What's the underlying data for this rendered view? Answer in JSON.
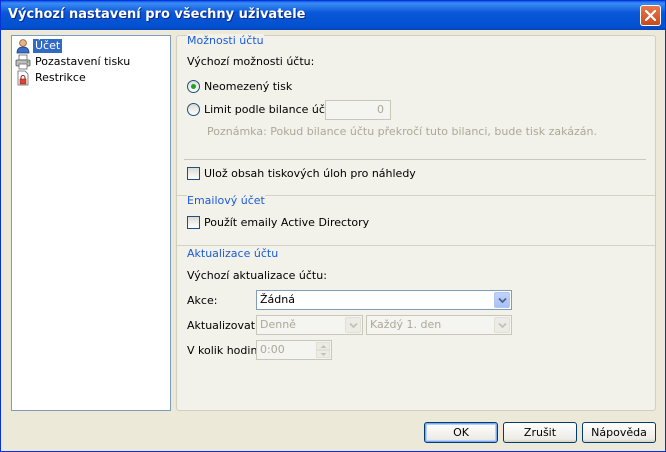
{
  "window": {
    "title": "Výchozí nastavení pro všechny uživatele"
  },
  "tree": {
    "items": [
      {
        "label": "Účet",
        "icon": "user-icon",
        "selected": true
      },
      {
        "label": "Pozastavení tisku",
        "icon": "printer-icon",
        "selected": false
      },
      {
        "label": "Restrikce",
        "icon": "document-lock-icon",
        "selected": false
      }
    ]
  },
  "account_options": {
    "title": "Možnosti účtu",
    "default_label": "Výchozí možnosti účtu:",
    "radio_unlimited": "Neomezený tisk",
    "radio_unlimited_selected": true,
    "radio_limit": "Limit podle bilance účtu:",
    "limit_value": "0",
    "note": "Poznámka: Pokud bilance účtu překročí tuto bilanci, bude tisk zakázán.",
    "store_previews": "Ulož obsah tiskových úloh pro náhledy"
  },
  "email_account": {
    "title": "Emailový účet",
    "use_ad_emails": "Použít emaily Active Directory"
  },
  "account_update": {
    "title": "Aktualizace účtu",
    "default_label": "Výchozí aktualizace účtu:",
    "action_label": "Akce:",
    "action_value": "Žádná",
    "update_label": "Aktualizovat:",
    "update_period": "Denně",
    "update_day": "Každý 1. den",
    "hour_label": "V kolik hodin:",
    "hour_value": "0:00"
  },
  "buttons": {
    "ok": "OK",
    "cancel": "Zrušit",
    "help": "Nápověda"
  },
  "colors": {
    "titlebar": "#0a57d9",
    "group_title": "#1c5bd3",
    "selection": "#316ac5"
  }
}
